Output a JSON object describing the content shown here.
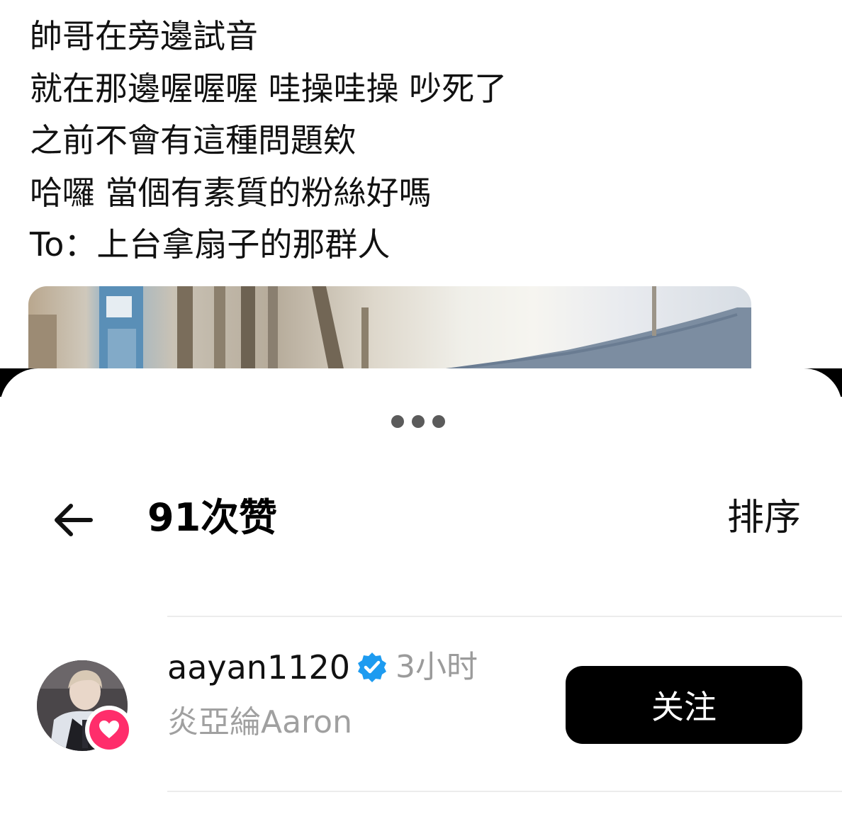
{
  "post": {
    "lines": [
      "帥哥在旁邊試音",
      "就在那邊喔喔喔 哇操哇操 吵死了",
      "之前不會有這種問題欸",
      "哈囉 當個有素質的粉絲好嗎",
      "To：上台拿扇子的那群人"
    ]
  },
  "likes_sheet": {
    "title": "91次赞",
    "sort_label": "排序",
    "back_icon": "arrow-left-icon",
    "more_icon": "more-dots-icon"
  },
  "users": [
    {
      "username": "aayan1120",
      "verified": true,
      "time": "3小时",
      "full_name": "炎亞綸Aaron",
      "follow_label": "关注",
      "badge_icon": "heart-icon"
    }
  ],
  "colors": {
    "verified_blue": "#1d9bf0",
    "heart_pink": "#ff2d6b",
    "follow_button": "#000000",
    "secondary_text": "#9b9b9b"
  }
}
